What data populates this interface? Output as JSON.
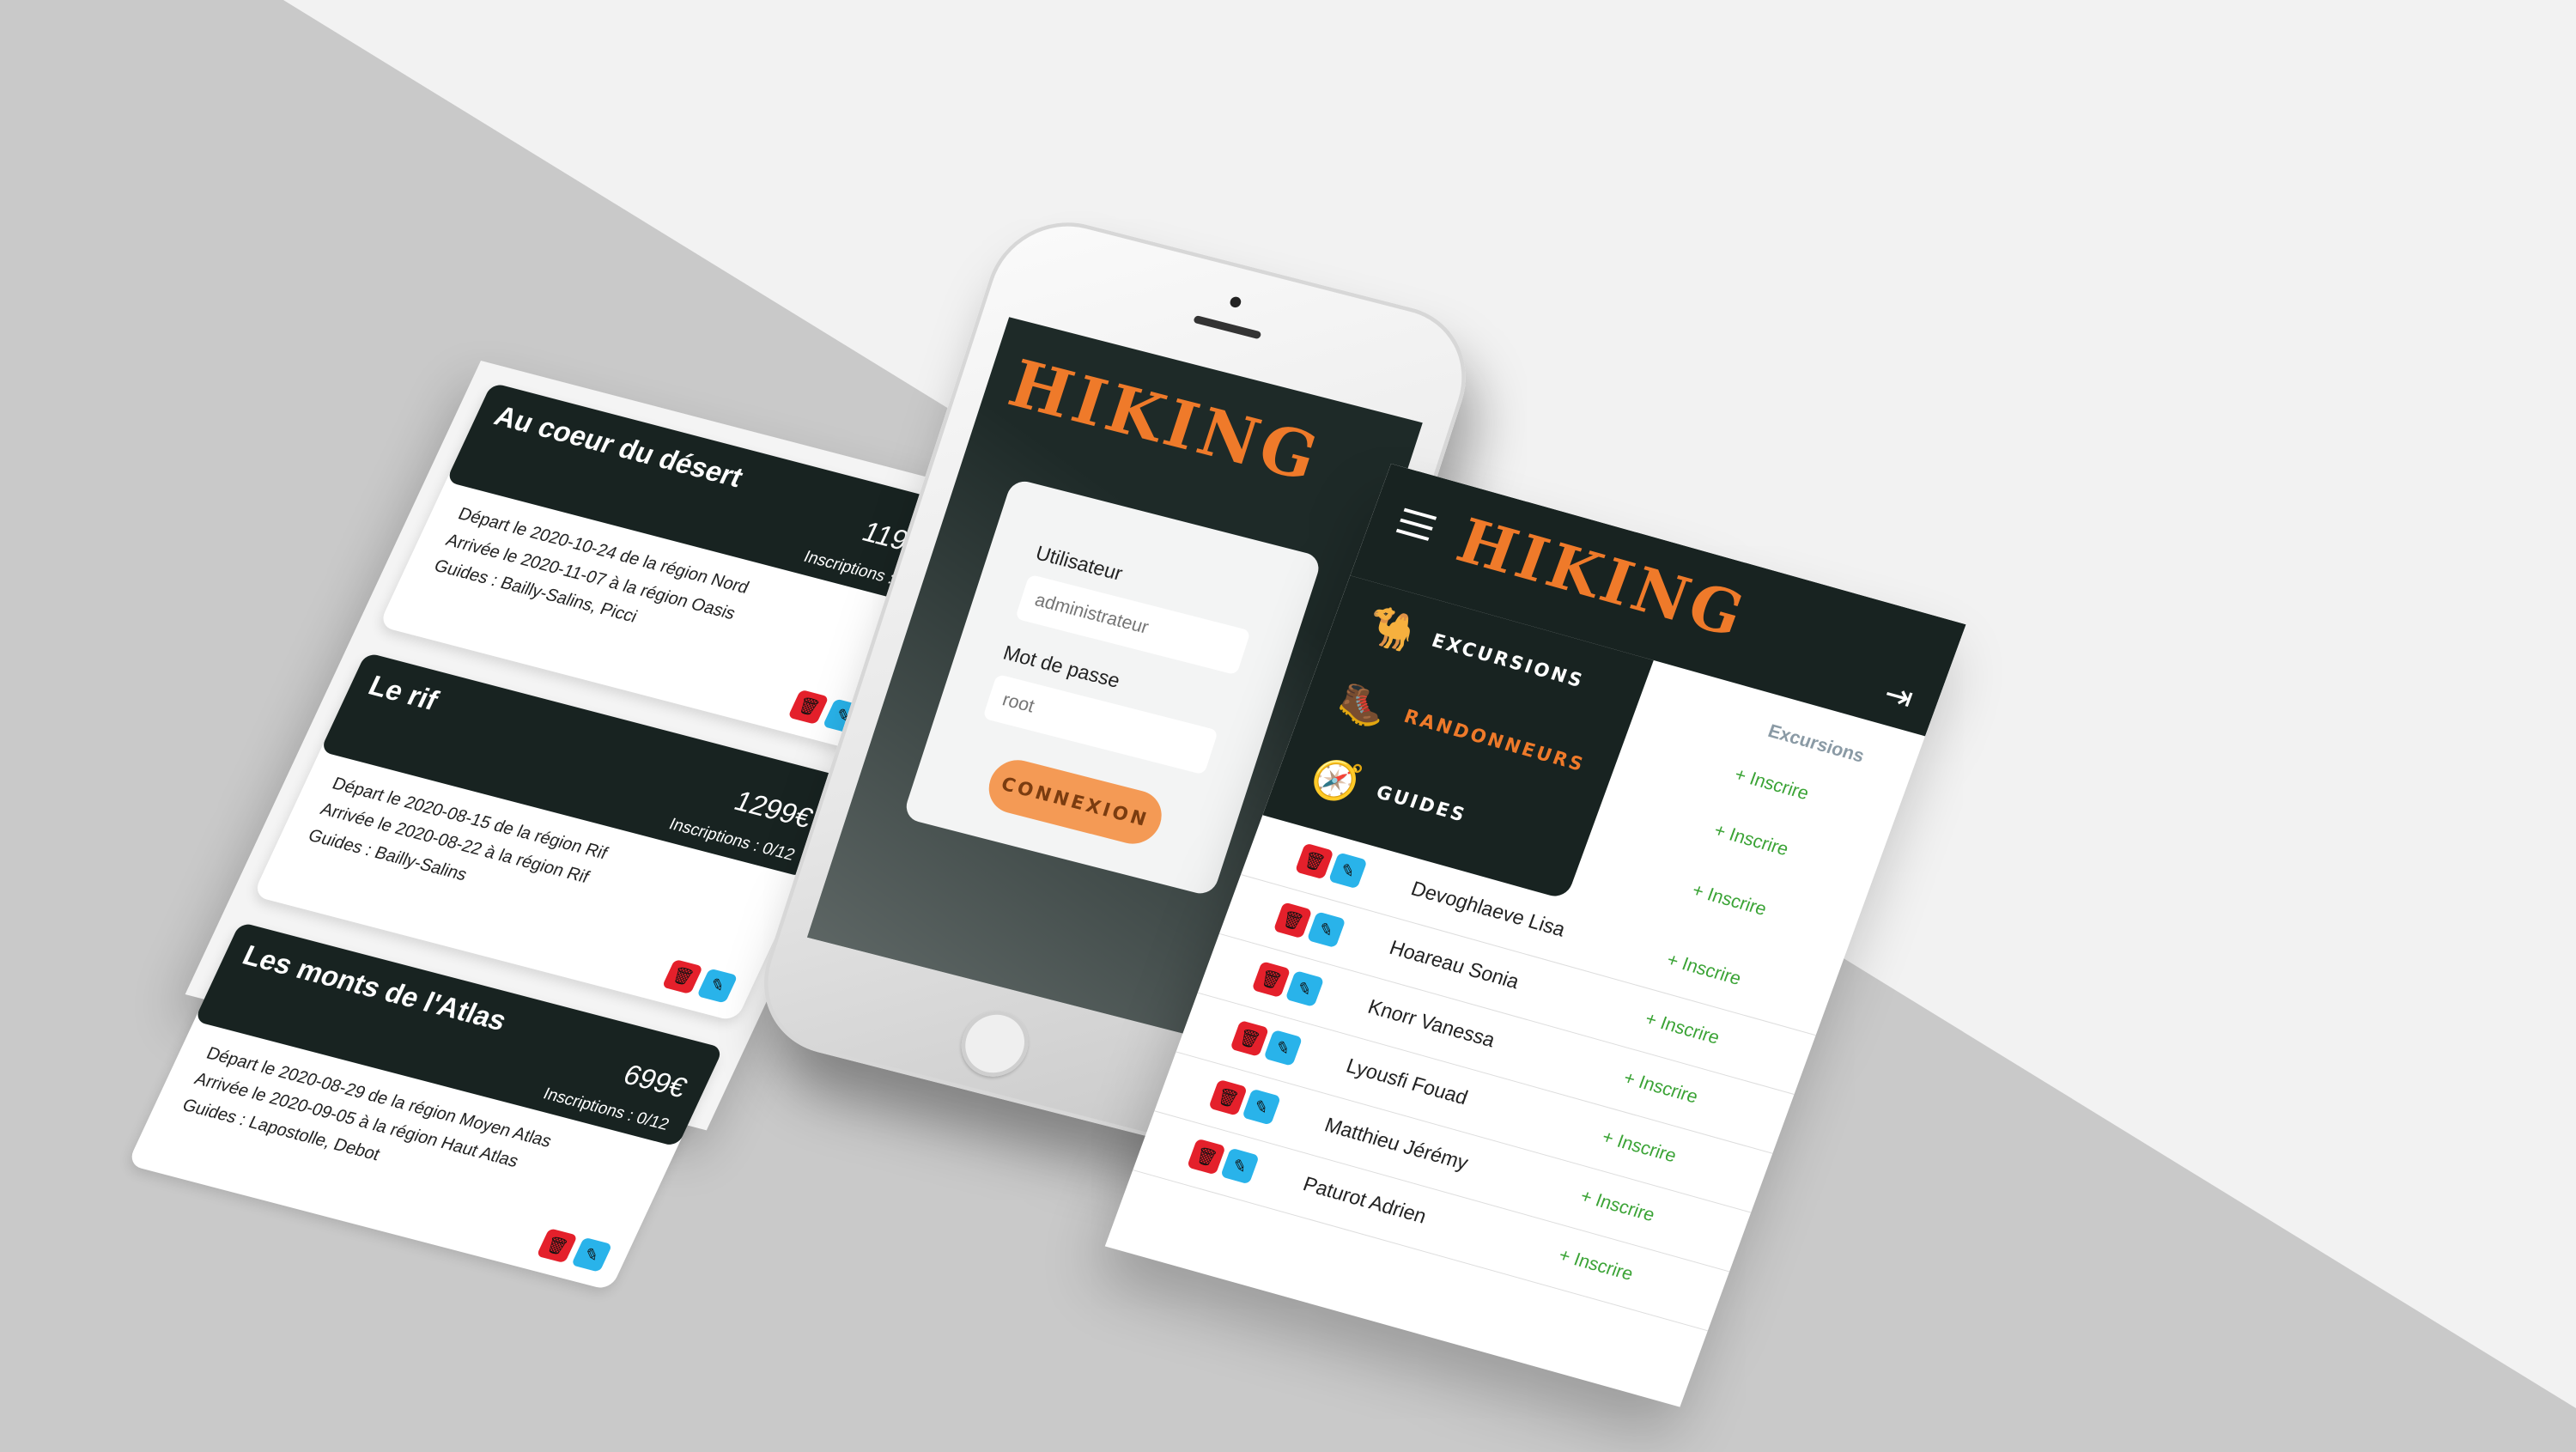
{
  "excursions": [
    {
      "title": "Au coeur du désert",
      "price": "1190€",
      "inscriptions": "Inscriptions : 0/6",
      "depart": "Départ le 2020-10-24 de la région Nord",
      "arrivee": "Arrivée le 2020-11-07 à la région Oasis",
      "guides": "Guides : Bailly-Salins, Picci"
    },
    {
      "title": "Le rif",
      "price": "1299€",
      "inscriptions": "Inscriptions : 0/12",
      "depart": "Départ le 2020-08-15 de la région Rif",
      "arrivee": "Arrivée le 2020-08-22 à la région Rif",
      "guides": "Guides : Bailly-Salins"
    },
    {
      "title": "Les monts de l'Atlas",
      "price": "699€",
      "inscriptions": "Inscriptions : 0/12",
      "depart": "Départ le 2020-08-29 de la région Moyen Atlas",
      "arrivee": "Arrivée le 2020-09-05 à la région Haut Atlas",
      "guides": "Guides : Lapostolle, Debot"
    }
  ],
  "login": {
    "logo": "HIKING",
    "user_label": "Utilisateur",
    "user_placeholder": "administrateur",
    "password_label": "Mot de passe",
    "password_placeholder": "root",
    "button": "CONNEXION"
  },
  "admin": {
    "logo": "HIKING",
    "menu": [
      {
        "label": "EXCURSIONS",
        "icon": "camel-icon",
        "color": "#ffffff"
      },
      {
        "label": "RANDONNEURS",
        "icon": "hiker-icon",
        "color": "#ef7a2a"
      },
      {
        "label": "GUIDES",
        "icon": "guide-icon",
        "color": "#ffffff"
      }
    ],
    "column_header": "Excursions",
    "inscrire_label": "+ Inscrire",
    "hikers": [
      "Devoghlaeve Lisa",
      "Hoareau Sonia",
      "Knorr Vanessa",
      "Lyousfi Fouad",
      "Matthieu Jérémy",
      "Paturot Adrien"
    ]
  },
  "colors": {
    "brand_orange": "#ef7a2a",
    "dark": "#182321",
    "delete_red": "#e4202b",
    "edit_blue": "#29b3ea",
    "success_green": "#3aa335"
  }
}
